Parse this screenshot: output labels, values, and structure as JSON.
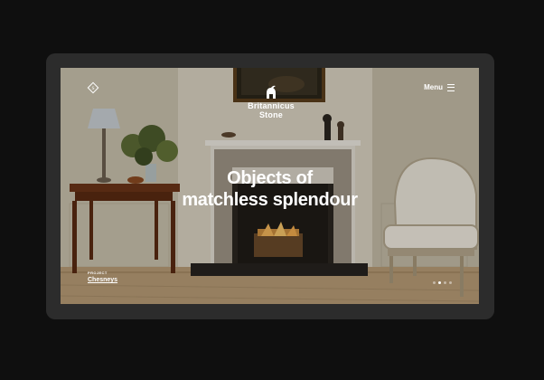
{
  "brand": {
    "name_line1": "Britannicus",
    "name_line2": "Stone",
    "logo_icon": "helmet-icon",
    "badge_icon": "diamond-monogram-icon"
  },
  "nav": {
    "menu_label": "Menu",
    "menu_icon": "hamburger-icon"
  },
  "hero": {
    "headline_line1": "Objects of",
    "headline_line2": "matchless splendour"
  },
  "project": {
    "kicker": "PROJECT",
    "name": "Chesneys"
  },
  "slides": {
    "count": 4,
    "active": 1
  },
  "colors": {
    "background": "#0f0f0f",
    "device_frame": "#2c2c2c",
    "text": "#ffffff"
  }
}
